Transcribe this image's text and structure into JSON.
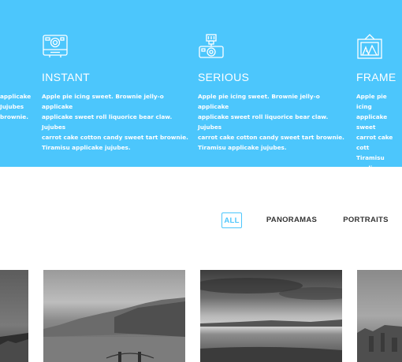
{
  "colors": {
    "accent": "#4cc6fc",
    "background": "#ffffff",
    "text_dark": "#333333"
  },
  "features": [
    {
      "icon": "camera-partial-icon",
      "title": "",
      "desc_lines": [
        "applicake",
        "Jujubes",
        "brownie.",
        ""
      ]
    },
    {
      "icon": "instant-camera-icon",
      "title": "INSTANT",
      "desc_lines": [
        "Apple pie icing sweet. Brownie jelly-o applicake",
        "applicake sweet roll liquorice bear claw. Jujubes",
        "carrot cake cotton candy sweet tart brownie.",
        "Tiramisu applicake jujubes."
      ]
    },
    {
      "icon": "flash-camera-icon",
      "title": "SERIOUS",
      "desc_lines": [
        "Apple pie icing sweet. Brownie jelly-o applicake",
        "applicake sweet roll liquorice bear claw. Jujubes",
        "carrot cake cotton candy sweet tart brownie.",
        "Tiramisu applicake jujubes."
      ]
    },
    {
      "icon": "framed-picture-icon",
      "title": "FRAME",
      "desc_lines": [
        "Apple pie icing",
        "applicake sweet",
        "carrot cake cott",
        "Tiramisu applica"
      ]
    }
  ],
  "filters": {
    "all": "ALL",
    "panoramas": "PANORAMAS",
    "portraits": "PORTRAITS"
  },
  "gallery": [
    {
      "name": "bridge-cropped"
    },
    {
      "name": "bay-bridge"
    },
    {
      "name": "sunset-sea"
    },
    {
      "name": "city-cropped"
    }
  ]
}
